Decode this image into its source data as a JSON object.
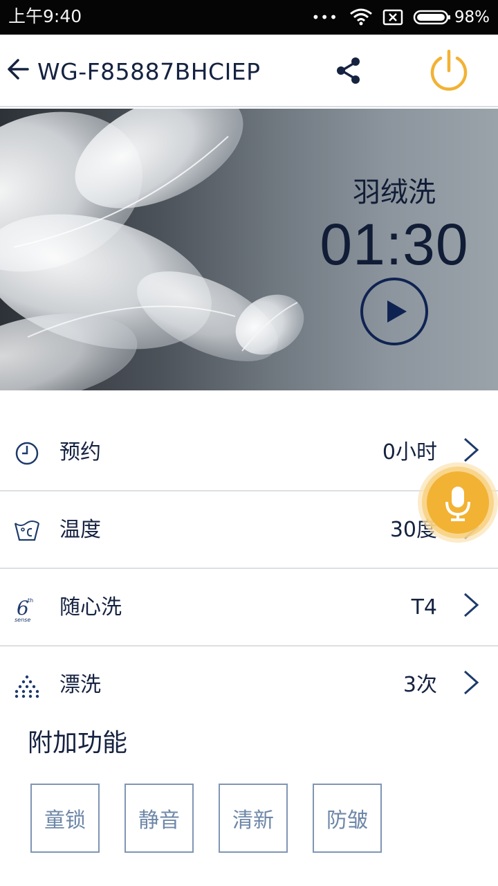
{
  "status_bar": {
    "time": "上午9:40",
    "dots": "•••",
    "battery": "98%",
    "icons": [
      "wifi-icon",
      "sim-off-icon",
      "battery-icon"
    ]
  },
  "header": {
    "title": "WG-F85887BHCIEP",
    "icons": [
      "back-arrow-icon",
      "share-icon",
      "power-icon"
    ],
    "accent_color": "#f2b233"
  },
  "banner": {
    "program_name": "羽绒洗",
    "program_time": "01:30",
    "play_icon": "play-icon",
    "text_color": "#111d36"
  },
  "settings": [
    {
      "icon": "clock-icon",
      "label": "预约",
      "value": "0小时"
    },
    {
      "icon": "temperature-icon",
      "label": "温度",
      "value": "30度"
    },
    {
      "icon": "sixth-sense-icon",
      "label": "随心洗",
      "value": "T4"
    },
    {
      "icon": "rinse-icon",
      "label": "漂洗",
      "value": "3次"
    }
  ],
  "voice": {
    "icon": "microphone-icon",
    "color": "#f2b233"
  },
  "extras": {
    "title": "附加功能",
    "buttons": [
      "童锁",
      "静音",
      "清新",
      "防皱"
    ],
    "border_color": "#7f95b4"
  }
}
